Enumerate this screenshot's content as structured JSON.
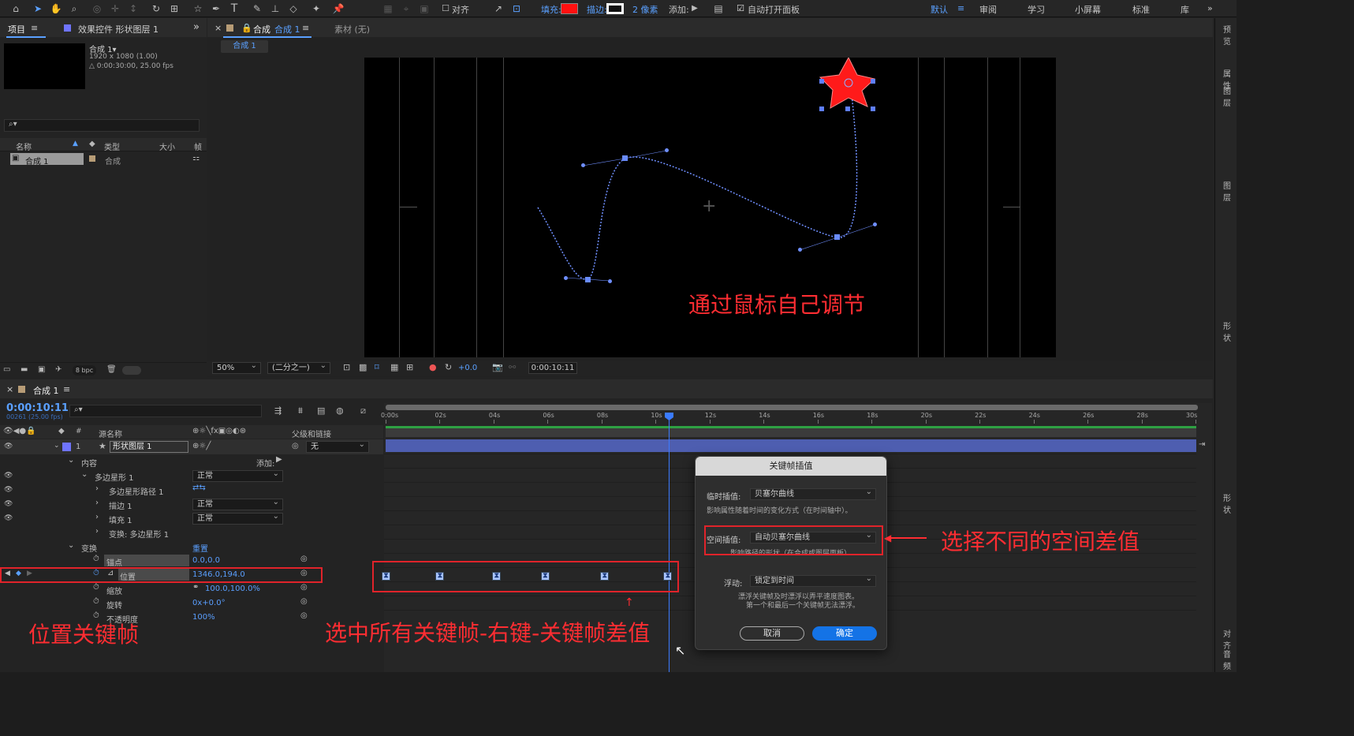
{
  "toolbar": {
    "align_label": "对齐",
    "fill_label": "填充:",
    "stroke_label": "描边:",
    "stroke_width": "2 像素",
    "add_label": "添加:",
    "auto_open_label": "自动打开面板",
    "workspaces": [
      "默认",
      "审阅",
      "学习",
      "小屏幕",
      "标准",
      "库"
    ],
    "active_workspace": "默认",
    "fill_color": "#ff1010"
  },
  "project": {
    "tab_label": "项目",
    "effects_tab_label": "效果控件 形状图层 1",
    "comp_name": "合成 1▾",
    "comp_size": "1920 x 1080 (1.00)",
    "comp_duration": "△ 0:00:30:00, 25.00 fps",
    "columns": [
      "名称",
      "类型",
      "大小",
      "帧"
    ],
    "items": [
      {
        "name": "合成 1",
        "type": "合成"
      }
    ],
    "bpc": "8 bpc"
  },
  "composition": {
    "tab_label": "合成",
    "tab_name": "合成 1",
    "footage_tab": "素材 (无)",
    "breadcrumb": "合成 1",
    "zoom": "50%",
    "resolution": "(二分之一)",
    "exposure": "+0.0",
    "timecode": "0:00:10:11",
    "annotation": "通过鼠标自己调节"
  },
  "timeline": {
    "tab_label": "合成 1",
    "timecode": "0:00:10:11",
    "frame_info": "00261 (25.00 fps)",
    "col_source": "源名称",
    "col_parent": "父级和链接",
    "ruler_labels": [
      "0:00s",
      "02s",
      "04s",
      "06s",
      "08s",
      "10s",
      "12s",
      "14s",
      "16s",
      "18s",
      "20s",
      "22s",
      "24s",
      "26s",
      "28s",
      "30s"
    ],
    "layer": {
      "index": "1",
      "name": "形状图层 1",
      "parent": "无"
    },
    "rows": {
      "contents": "内容",
      "add": "添加:",
      "polystar": "多边星形 1",
      "polystar_mode": "正常",
      "polystar_path": "多边星形路径 1",
      "stroke": "描边 1",
      "stroke_mode": "正常",
      "fill": "填充 1",
      "fill_mode": "正常",
      "transform_poly": "变换: 多边星形 1",
      "transform": "变换",
      "reset": "重置",
      "anchor": "锚点",
      "anchor_val": "0.0,0.0",
      "position": "位置",
      "position_val": "1346.0,194.0",
      "scale": "缩放",
      "scale_val": "100.0,100.0%",
      "rotation": "旋转",
      "rotation_val": "0x+0.0°",
      "opacity": "不透明度",
      "opacity_val": "100%"
    },
    "annotation_left": "位置关键帧",
    "annotation_bottom": "选中所有关键帧-右键-关键帧差值"
  },
  "dialog": {
    "title": "关键帧插值",
    "temporal_label": "临时插值:",
    "temporal_value": "贝塞尔曲线",
    "temporal_desc": "影响属性随着时间的变化方式（在时间轴中）。",
    "spatial_label": "空间插值:",
    "spatial_value": "自动贝塞尔曲线",
    "spatial_desc": "影响路径的形状（在合成或图层面板）。",
    "roving_label": "浮动:",
    "roving_value": "锁定到时间",
    "roving_desc1": "漂浮关键帧及时漂浮以弄平速度图表。",
    "roving_desc2": "第一个和最后一个关键帧无法漂浮。",
    "cancel": "取消",
    "ok": "确定"
  },
  "annotation_right": "选择不同的空间差值",
  "right_panel": {
    "preview": "预览",
    "properties": "属性",
    "layer": "图层",
    "shape": "形状",
    "align": "对齐",
    "audio": "音频"
  }
}
